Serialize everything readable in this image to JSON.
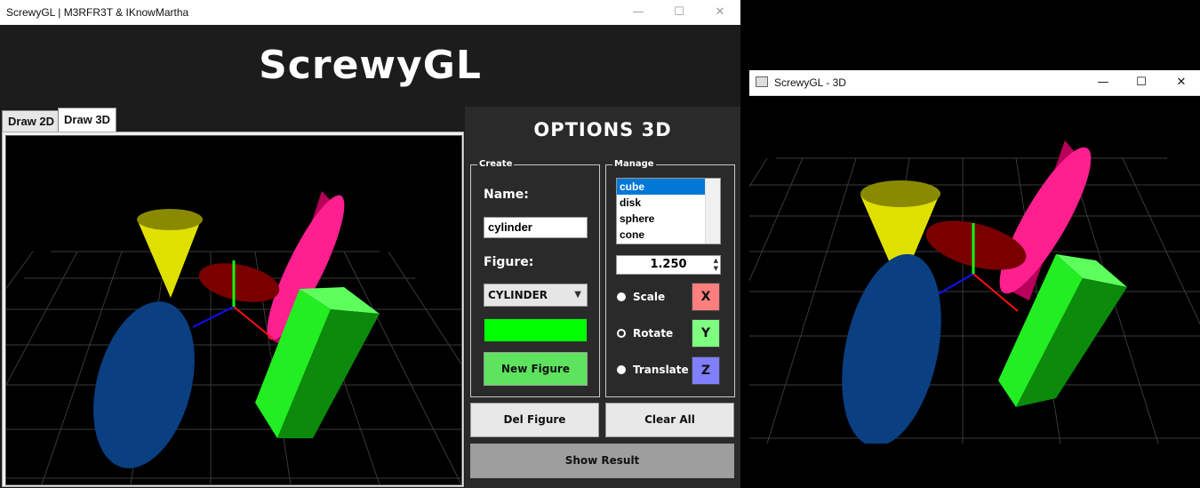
{
  "main_window": {
    "title": "ScrewyGL | M3RFR3T & IKnowMartha",
    "controls": {
      "minimize": "—",
      "maximize": "☐",
      "close": "✕"
    }
  },
  "header": {
    "logo": "ScrewyGL"
  },
  "tabs": [
    {
      "label": "Draw 2D",
      "active": false
    },
    {
      "label": "Draw 3D",
      "active": true
    }
  ],
  "options": {
    "title": "OPTIONS 3D",
    "create": {
      "legend": "Create",
      "name_label": "Name:",
      "name_value": "cylinder",
      "figure_label": "Figure:",
      "figure_value": "CYLINDER",
      "color": "#00ff00",
      "new_button": "New Figure"
    },
    "manage": {
      "legend": "Manage",
      "list": [
        "cube",
        "disk",
        "sphere",
        "cone"
      ],
      "selected": "cube",
      "spin_value": "1.250",
      "radios": [
        {
          "label": "Scale",
          "checked": true
        },
        {
          "label": "Rotate",
          "checked": false
        },
        {
          "label": "Translate",
          "checked": true
        }
      ],
      "axes": [
        {
          "label": "X",
          "color": "#ff7f7f"
        },
        {
          "label": "Y",
          "color": "#7fff7f"
        },
        {
          "label": "Z",
          "color": "#7f7fff"
        }
      ]
    },
    "del_button": "Del Figure",
    "clear_button": "Clear All",
    "show_button": "Show Result"
  },
  "second_window": {
    "title": "ScrewyGL - 3D",
    "controls": {
      "minimize": "—",
      "maximize": "☐",
      "close": "✕"
    }
  },
  "colors": {
    "cone": "#ffff00",
    "disk": "#800000",
    "ellipsoid": "#00408f",
    "box": "#00ff00",
    "pink": "#ff0080",
    "new_button_bg": "#5ee35e"
  }
}
